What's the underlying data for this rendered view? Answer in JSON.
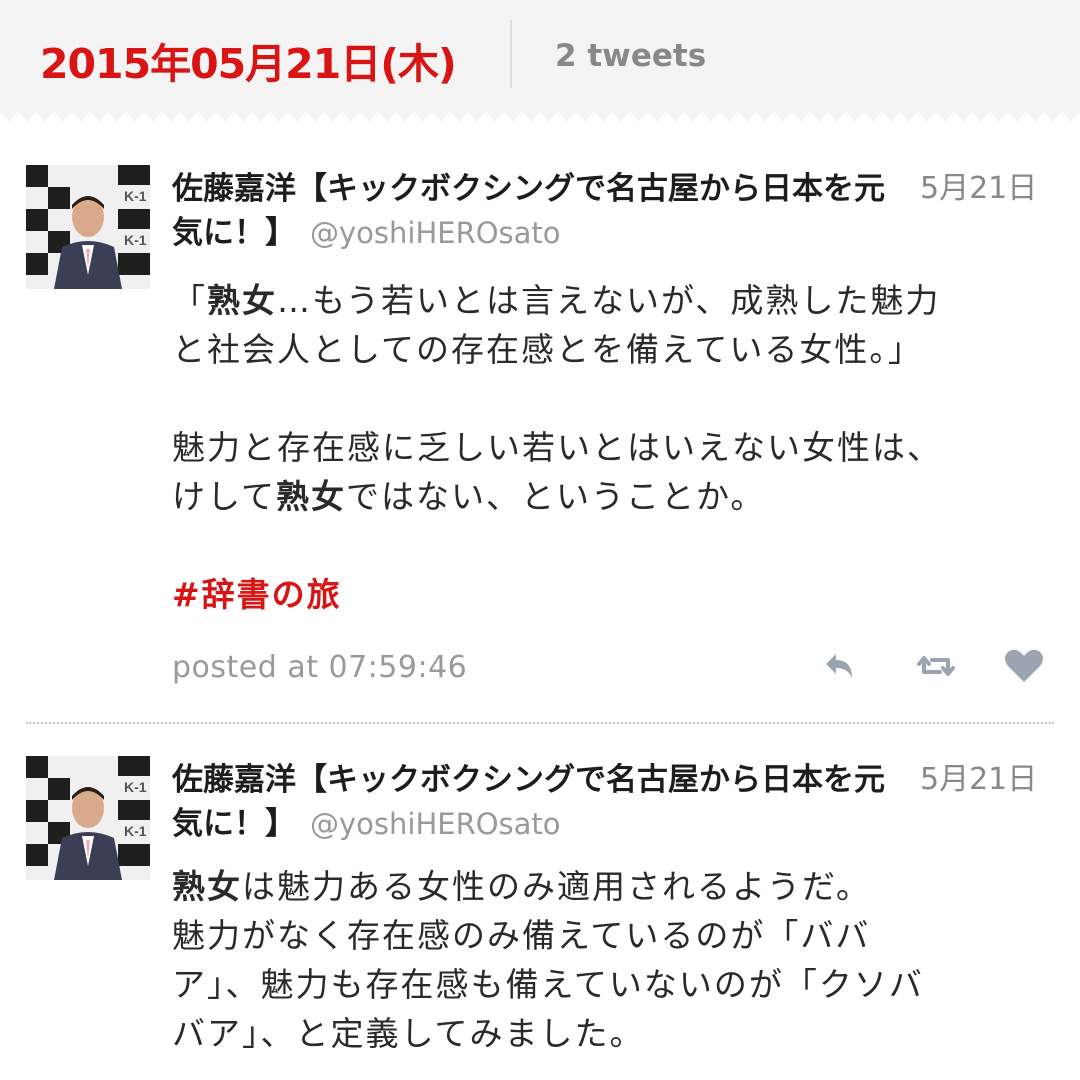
{
  "header": {
    "date": "2015年05月21日(木)",
    "count": "2 tweets"
  },
  "tweets": [
    {
      "author_name": "佐藤嘉洋【キックボクシングで名古屋から日本を元気に！】",
      "handle": "@yoshiHEROsato",
      "date": "5月21日",
      "body": {
        "line1_pre": "「",
        "line1_bold": "熟女",
        "line1_post": "…もう若いとは言えないが、成熟した魅力",
        "line2": "と社会人としての存在感とを備えている女性。」",
        "line3": "魅力と存在感に乏しい若いとはいえない女性は、",
        "line4_pre": "けして",
        "line4_bold": "熟女",
        "line4_post": "ではない、ということか。",
        "hashtag": "#辞書の旅"
      },
      "posted": "posted at 07:59:46"
    },
    {
      "author_name": "佐藤嘉洋【キックボクシングで名古屋から日本を元気に！】",
      "handle": "@yoshiHEROsato",
      "date": "5月21日",
      "body": {
        "line1_bold": "熟女",
        "line1_post": "は魅力ある女性のみ適用されるようだ。",
        "line2": "魅力がなく存在感のみ備えているのが「ババ",
        "line3": "ア」、魅力も存在感も備えていないのが「クソバ",
        "line4": "バア」、と定義してみました。"
      }
    }
  ],
  "colors": {
    "accent_red": "#d81414",
    "muted_gray": "#9a9a9a",
    "action_icon": "#9aa5b1"
  }
}
